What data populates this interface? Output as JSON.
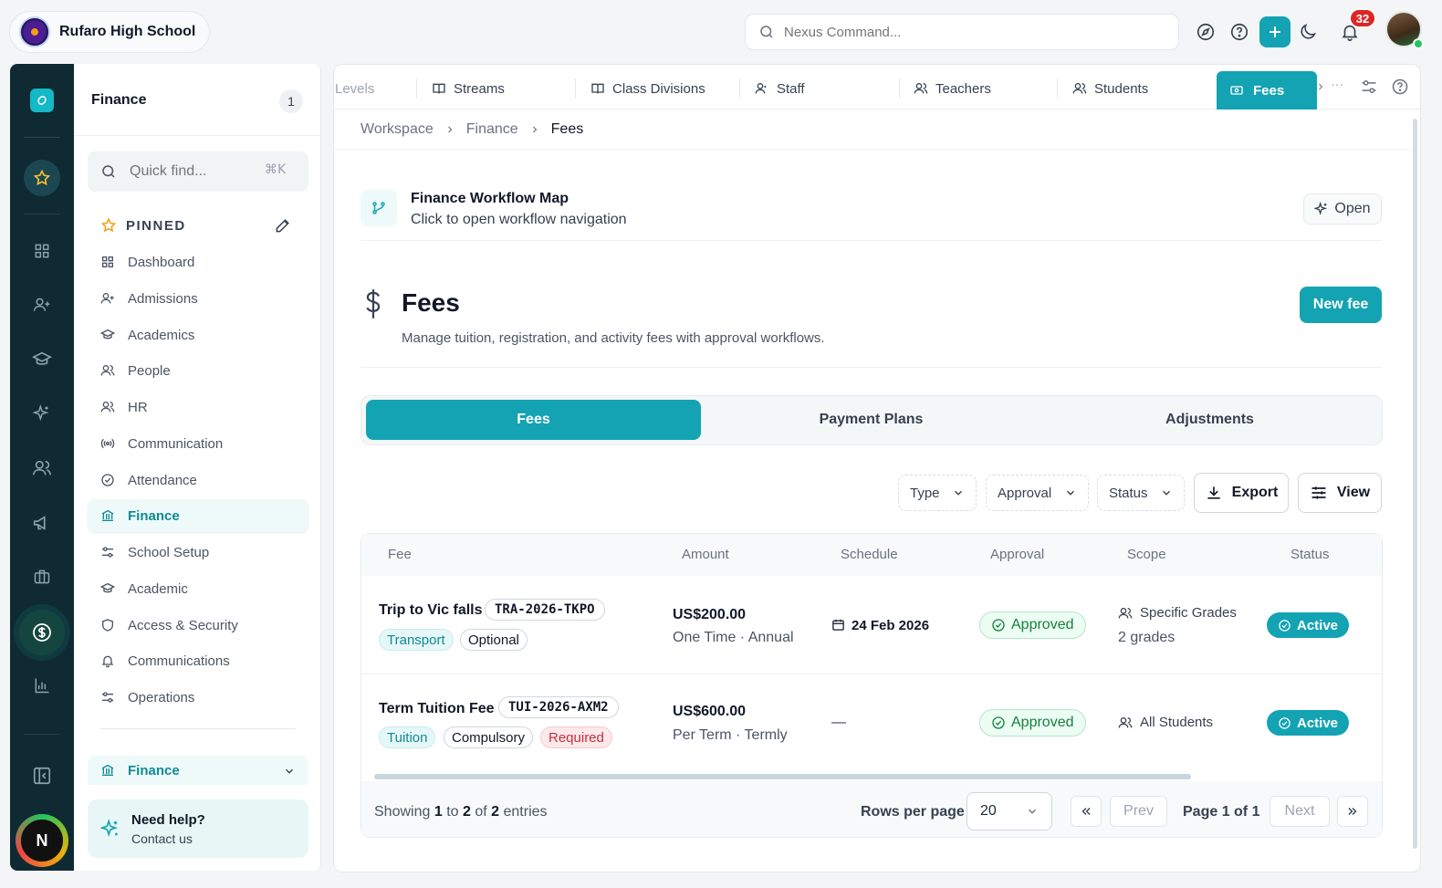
{
  "header": {
    "school_name": "Rufaro High School",
    "command_placeholder": "Nexus Command...",
    "notifications_count": "32"
  },
  "sidebar": {
    "title": "Finance",
    "count": "1",
    "quick_find_placeholder": "Quick find...",
    "quick_find_shortcut": "⌘K",
    "pinned_label": "PINNED",
    "items": [
      {
        "label": "Dashboard",
        "icon": "grid-icon"
      },
      {
        "label": "Admissions",
        "icon": "user-plus-icon"
      },
      {
        "label": "Academics",
        "icon": "graduation-cap-icon"
      },
      {
        "label": "People",
        "icon": "users-icon"
      },
      {
        "label": "HR",
        "icon": "users-icon"
      },
      {
        "label": "Communication",
        "icon": "broadcast-icon"
      },
      {
        "label": "Attendance",
        "icon": "check-circle-icon"
      },
      {
        "label": "Finance",
        "icon": "bank-icon",
        "active": true
      },
      {
        "label": "School Setup",
        "icon": "sliders-icon"
      },
      {
        "label": "Academic",
        "icon": "graduation-cap-icon"
      },
      {
        "label": "Access & Security",
        "icon": "shield-icon"
      },
      {
        "label": "Communications",
        "icon": "bell-icon"
      },
      {
        "label": "Operations",
        "icon": "sliders-icon"
      }
    ],
    "section_select": "Finance",
    "help_title": "Need help?",
    "help_sub": "Contact us"
  },
  "rail": {
    "user_initial": "N"
  },
  "tabs": [
    {
      "label": "Levels"
    },
    {
      "label": "Streams"
    },
    {
      "label": "Class Divisions"
    },
    {
      "label": "Staff"
    },
    {
      "label": "Teachers"
    },
    {
      "label": "Students"
    },
    {
      "label": "Fees",
      "active": true
    }
  ],
  "breadcrumb": [
    "Workspace",
    "Finance",
    "Fees"
  ],
  "workflow": {
    "title": "Finance Workflow Map",
    "subtitle": "Click to open workflow navigation",
    "open_label": "Open"
  },
  "page": {
    "title": "Fees",
    "subtitle": "Manage tuition, registration, and activity fees with approval workflows.",
    "new_button": "New fee"
  },
  "segments": [
    "Fees",
    "Payment Plans",
    "Adjustments"
  ],
  "filters": {
    "type": "Type",
    "approval": "Approval",
    "status": "Status",
    "export": "Export",
    "view": "View"
  },
  "table": {
    "columns": [
      "Fee",
      "Amount",
      "Schedule",
      "Approval",
      "Scope",
      "Status"
    ],
    "rows": [
      {
        "name": "Trip to Vic falls",
        "code": "TRA-2026-TKPO",
        "tags": [
          {
            "label": "Transport",
            "style": "teal"
          },
          {
            "label": "Optional",
            "style": "plain"
          }
        ],
        "amount": "US$200.00",
        "amount_sub": "One Time · Annual",
        "schedule": "24 Feb 2026",
        "approval": "Approved",
        "scope": "Specific Grades",
        "scope_sub": "2 grades",
        "status": "Active"
      },
      {
        "name": "Term Tuition Fee",
        "code": "TUI-2026-AXM2",
        "tags": [
          {
            "label": "Tuition",
            "style": "teal"
          },
          {
            "label": "Compulsory",
            "style": "plain"
          },
          {
            "label": "Required",
            "style": "red"
          }
        ],
        "amount": "US$600.00",
        "amount_sub": "Per Term · Termly",
        "schedule": "—",
        "approval": "Approved",
        "scope": "All Students",
        "scope_sub": "",
        "status": "Active"
      }
    ]
  },
  "footer": {
    "showing_prefix": "Showing",
    "from": "1",
    "to_word": "to",
    "to": "2",
    "of_word": "of",
    "total": "2",
    "entries_word": "entries",
    "rows_per_page_label": "Rows per page",
    "rows_per_page": "20",
    "prev": "Prev",
    "page_label": "Page 1 of 1",
    "next": "Next"
  },
  "colors": {
    "accent": "#14a3b3",
    "rail": "#0f2a33",
    "approved": "#15803d",
    "required": "#c2303e"
  }
}
